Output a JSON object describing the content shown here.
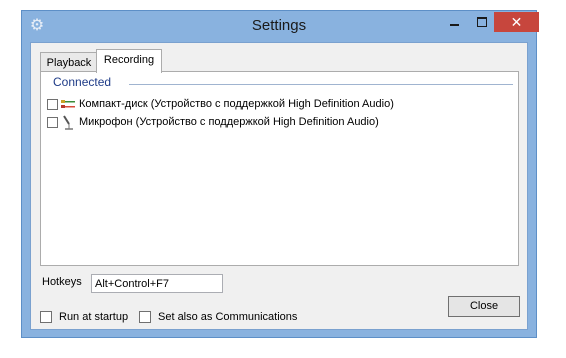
{
  "window": {
    "title": "Settings",
    "icon": "gear-icon",
    "close_glyph": "✕"
  },
  "tabs": [
    {
      "label": "Playback",
      "selected": false
    },
    {
      "label": "Recording",
      "selected": true
    }
  ],
  "recording": {
    "group_label": "Connected",
    "devices": [
      {
        "label": "Компакт-диск (Устройство с поддержкой High Definition Audio)",
        "checked": false,
        "icon": "cd-audio-icon"
      },
      {
        "label": "Микрофон (Устройство с поддержкой High Definition Audio)",
        "checked": false,
        "icon": "microphone-icon"
      }
    ]
  },
  "hotkeys": {
    "label": "Hotkeys",
    "value": "Alt+Control+F7"
  },
  "options": {
    "run_at_startup": {
      "label": "Run at startup",
      "checked": false
    },
    "set_communications": {
      "label": "Set also as Communications",
      "checked": false
    }
  },
  "buttons": {
    "close_label": "Close"
  },
  "colors": {
    "window_frame": "#89b2df",
    "close_button": "#c7463d",
    "group_header": "#1e3b87"
  }
}
